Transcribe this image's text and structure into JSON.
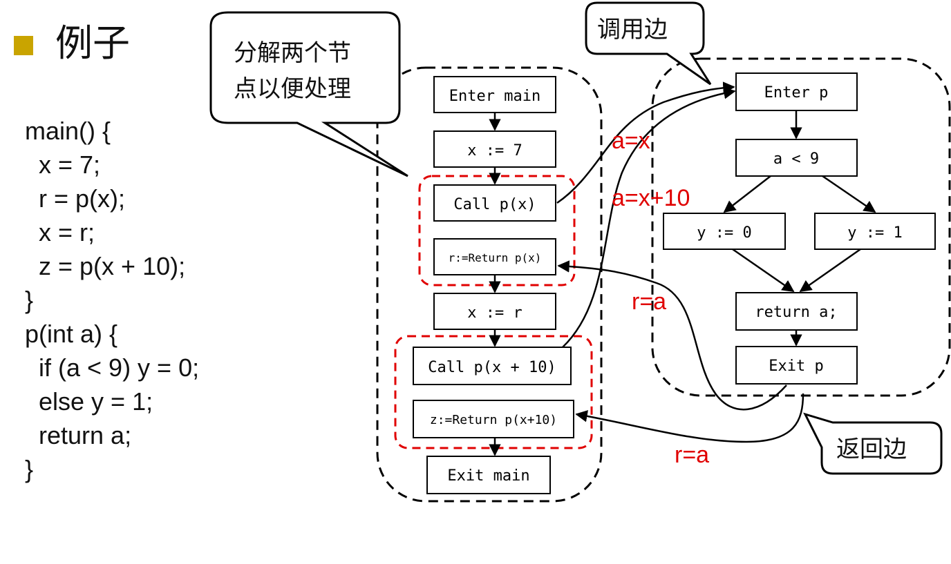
{
  "slide": {
    "title": "例子",
    "code_lines": [
      "main() {",
      "  x = 7;",
      "  r = p(x);",
      "  x = r;",
      "  z = p(x + 10);",
      "}",
      "p(int a) {",
      "  if (a < 9) y = 0;",
      "  else y = 1;",
      "  return a;",
      "}"
    ]
  },
  "main_nodes": {
    "enter": "Enter main",
    "x7": "x := 7",
    "call1": "Call p(x)",
    "ret1": "r:=Return p(x)",
    "xr": "x := r",
    "call2": "Call p(x + 10)",
    "ret2": "z:=Return p(x+10)",
    "exit": "Exit main"
  },
  "p_nodes": {
    "enter": "Enter p",
    "cond": "a < 9",
    "y0": "y := 0",
    "y1": "y := 1",
    "ret": "return a;",
    "exit": "Exit p"
  },
  "edge_labels": {
    "call1": "a=x",
    "call2": "a=x+10",
    "ret1": "r=a",
    "ret2": "r=a"
  },
  "callouts": {
    "split": [
      "分解两个节",
      "点以便处理"
    ],
    "call_edge": "调用边",
    "return_edge": "返回边"
  },
  "colors": {
    "highlight": "#e00000",
    "bullet": "#c9a400"
  }
}
